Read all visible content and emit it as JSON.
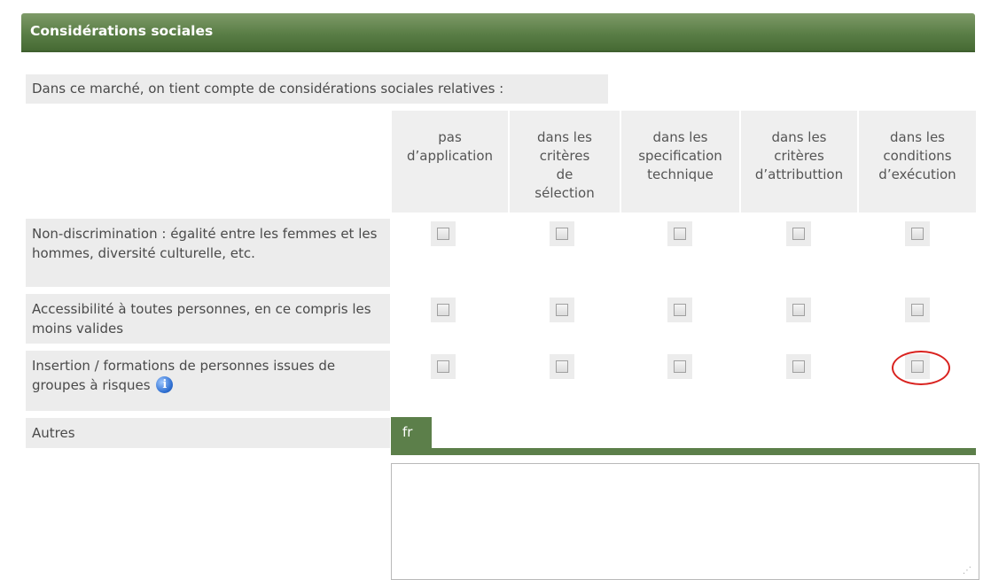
{
  "section": {
    "title": "Considérations sociales"
  },
  "intro": "Dans ce marché, on tient compte de considérations sociales relatives :",
  "columns": [
    "pas\nd’application",
    "dans les\ncritères\nde\nsélection",
    "dans les\nspecification\ntechnique",
    "dans les\ncritères\nd’attributtion",
    "dans les\nconditions\nd’exécution"
  ],
  "rows": [
    {
      "label": "Non-discrimination : égalité entre les femmes et les hommes, diversité culturelle, etc.",
      "checked": [
        false,
        false,
        false,
        false,
        false
      ]
    },
    {
      "label": "Accessibilité à toutes personnes, en ce compris les moins valides",
      "checked": [
        false,
        false,
        false,
        false,
        false
      ]
    },
    {
      "label": "Insertion / formations de personnes issues de groupes à risques",
      "checked": [
        false,
        false,
        false,
        false,
        false
      ]
    }
  ],
  "other": {
    "label": "Autres",
    "language_tab": "fr",
    "value": ""
  },
  "icons": {
    "info": "info-icon",
    "resize": "resize-grip-icon"
  },
  "colors": {
    "header": "#5a7e46",
    "tab": "#5c7f4a",
    "highlight_ring": "#d9221f"
  }
}
